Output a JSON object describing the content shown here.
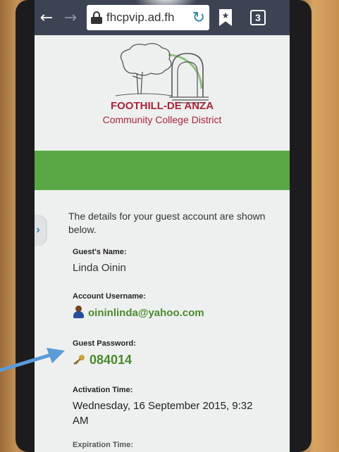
{
  "browser": {
    "back_icon": "arrow-left-icon",
    "forward_icon": "arrow-right-icon",
    "url": "fhcpvip.ad.fh",
    "tab_count": "3"
  },
  "header": {
    "org_name": "FOOTHILL-DE ANZA",
    "org_subtitle": "Community College District",
    "accent_color": "#a8243a",
    "band_color": "#5aa845"
  },
  "details": {
    "intro": "The details for your guest account are shown below.",
    "name_label": "Guest's Name:",
    "name_value": "Linda Oinin",
    "username_label": "Account Username:",
    "username_value": "oininlinda@yahoo.com",
    "password_label": "Guest Password:",
    "password_value": "084014",
    "activation_label": "Activation Time:",
    "activation_value": "Wednesday, 16 September 2015, 9:32 AM",
    "expiration_label": "Expiration Time:"
  }
}
